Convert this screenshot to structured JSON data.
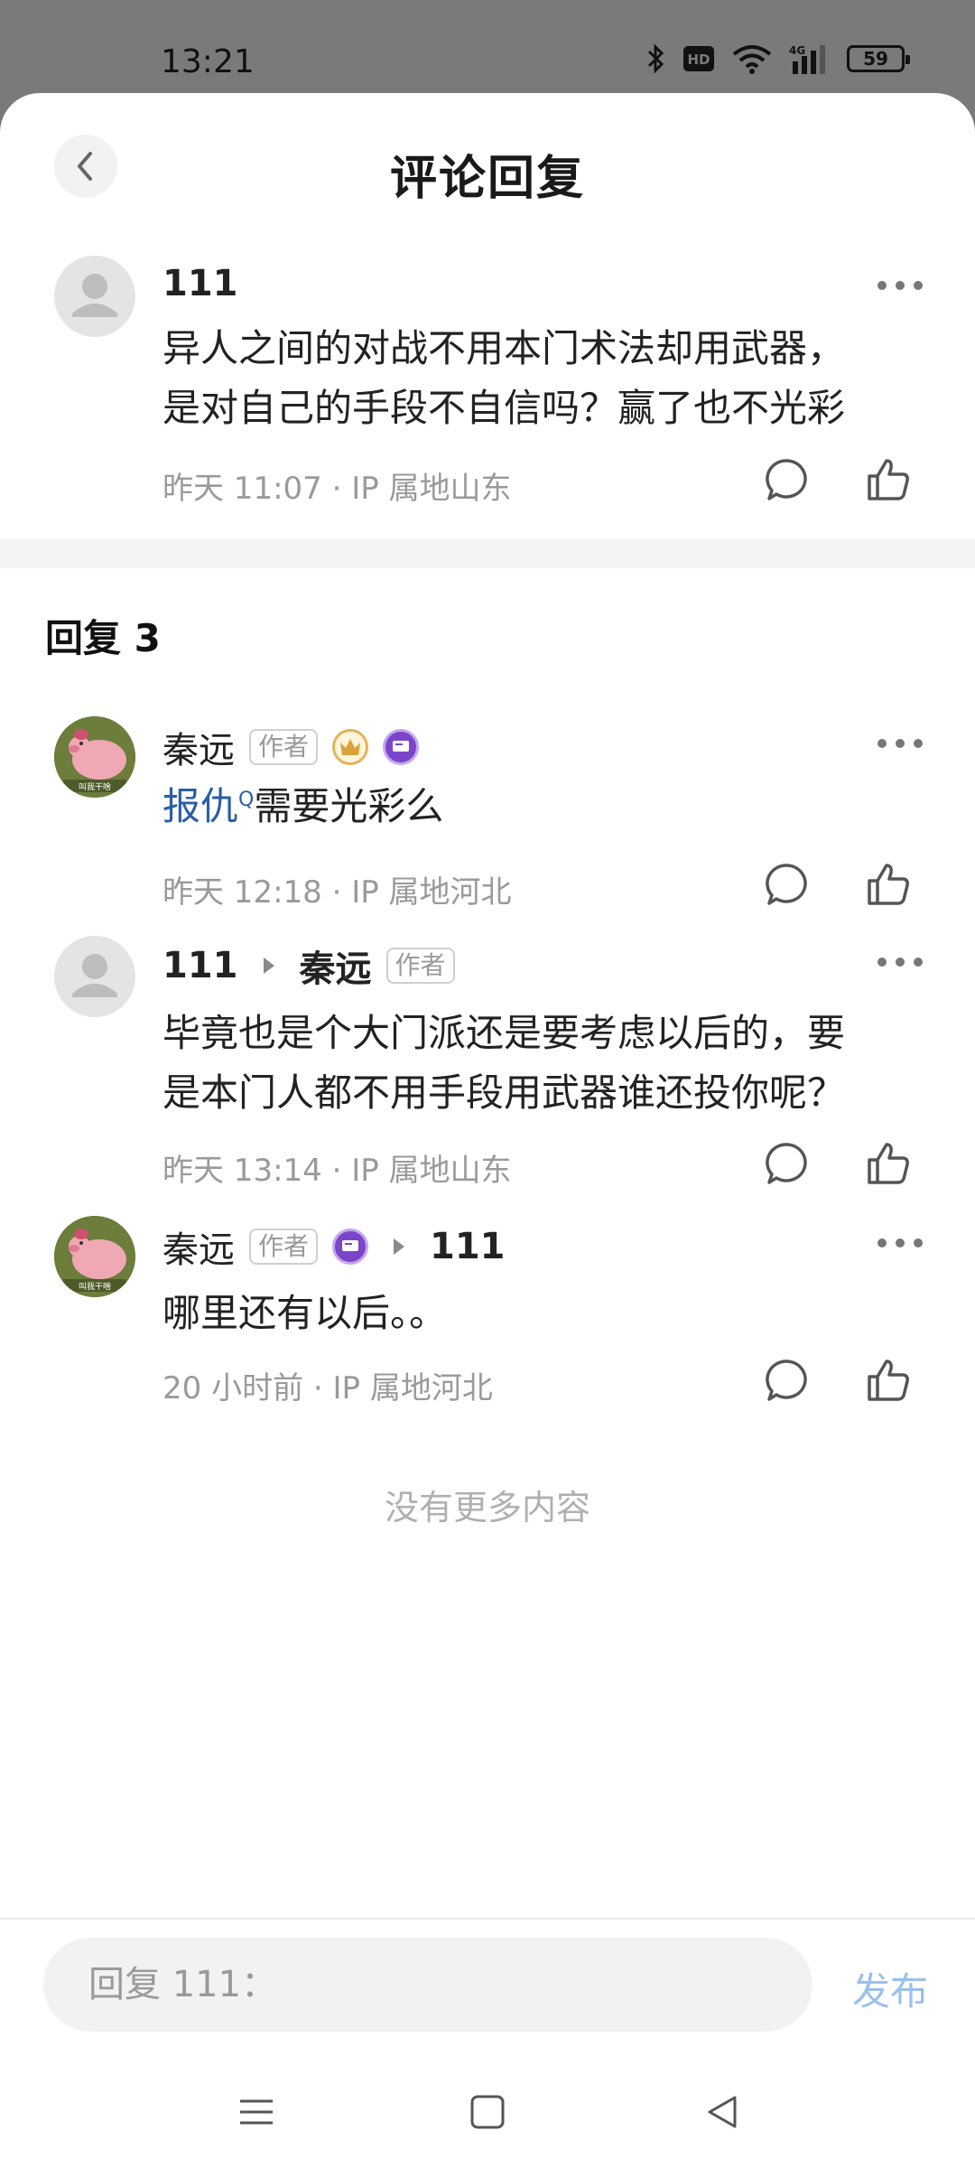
{
  "status": {
    "time": "13:21",
    "hd": "HD",
    "net": "4G",
    "battery": "59"
  },
  "header": {
    "title": "评论回复"
  },
  "main_comment": {
    "user": "111",
    "text_line1": "异人之间的对战不用本门术法却用武器，",
    "text_line2": "是对自己的手段不自信吗？赢了也不光彩",
    "meta": "昨天 11:07 · IP 属地山东"
  },
  "replies_header": "回复 3",
  "replies": [
    {
      "user": "秦远",
      "tag": "作者",
      "link_text": "报仇",
      "link_mark": "Q",
      "text_rest": "需要光彩么",
      "meta": "昨天 12:18 · IP 属地河北"
    },
    {
      "user": "111",
      "reply_to": "秦远",
      "tag": "作者",
      "text_line1": "毕竟也是个大门派还是要考虑以后的，要",
      "text_line2": "是本门人都不用手段用武器谁还投你呢？",
      "meta": "昨天 13:14 · IP 属地山东"
    },
    {
      "user": "秦远",
      "tag": "作者",
      "reply_to": "111",
      "text": "哪里还有以后。。",
      "meta": "20 小时前 · IP 属地河北"
    }
  ],
  "avatar_caption": "叫我干啥",
  "no_more": "没有更多内容",
  "composer": {
    "placeholder": "回复 111：",
    "publish": "发布"
  },
  "colors": {
    "link": "#2a5ea8",
    "publish": "#9ac0ec",
    "divider": "#f3f3f3"
  }
}
